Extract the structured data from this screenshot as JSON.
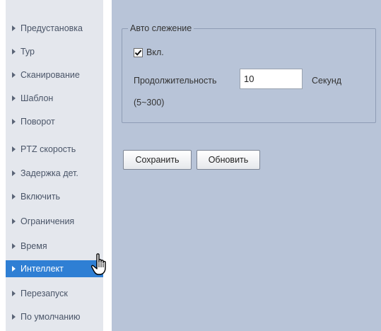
{
  "sidebar": {
    "items": [
      {
        "label": "Предустановка"
      },
      {
        "label": "Тур"
      },
      {
        "label": "Сканирование"
      },
      {
        "label": "Шаблон"
      },
      {
        "label": "Поворот"
      },
      {
        "label": "PTZ скорость"
      },
      {
        "label": "Задержка дет."
      },
      {
        "label": "Включить"
      },
      {
        "label": "Ограничения"
      },
      {
        "label": "Время"
      },
      {
        "label": "Интеллект"
      },
      {
        "label": "Перезапуск"
      },
      {
        "label": "По умолчанию"
      }
    ],
    "active_item": "Интеллект"
  },
  "auto_tracking": {
    "legend": "Авто слежение",
    "enable_label": "Вкл.",
    "enable_checked": true,
    "duration_label": "Продолжительность",
    "duration_value": "10",
    "unit_label": "Секунд",
    "range_hint": "(5~300)"
  },
  "actions": {
    "save_label": "Сохранить",
    "refresh_label": "Обновить"
  },
  "colors": {
    "sidebar_bg": "#e4e7ed",
    "active_item_bg": "#2f7fd4",
    "content_bg": "#b8c4d8"
  },
  "icons": {
    "sidebar_arrow": "triangle-right-icon",
    "cursor": "hand-pointer-icon",
    "checkbox": "checkmark-icon"
  }
}
